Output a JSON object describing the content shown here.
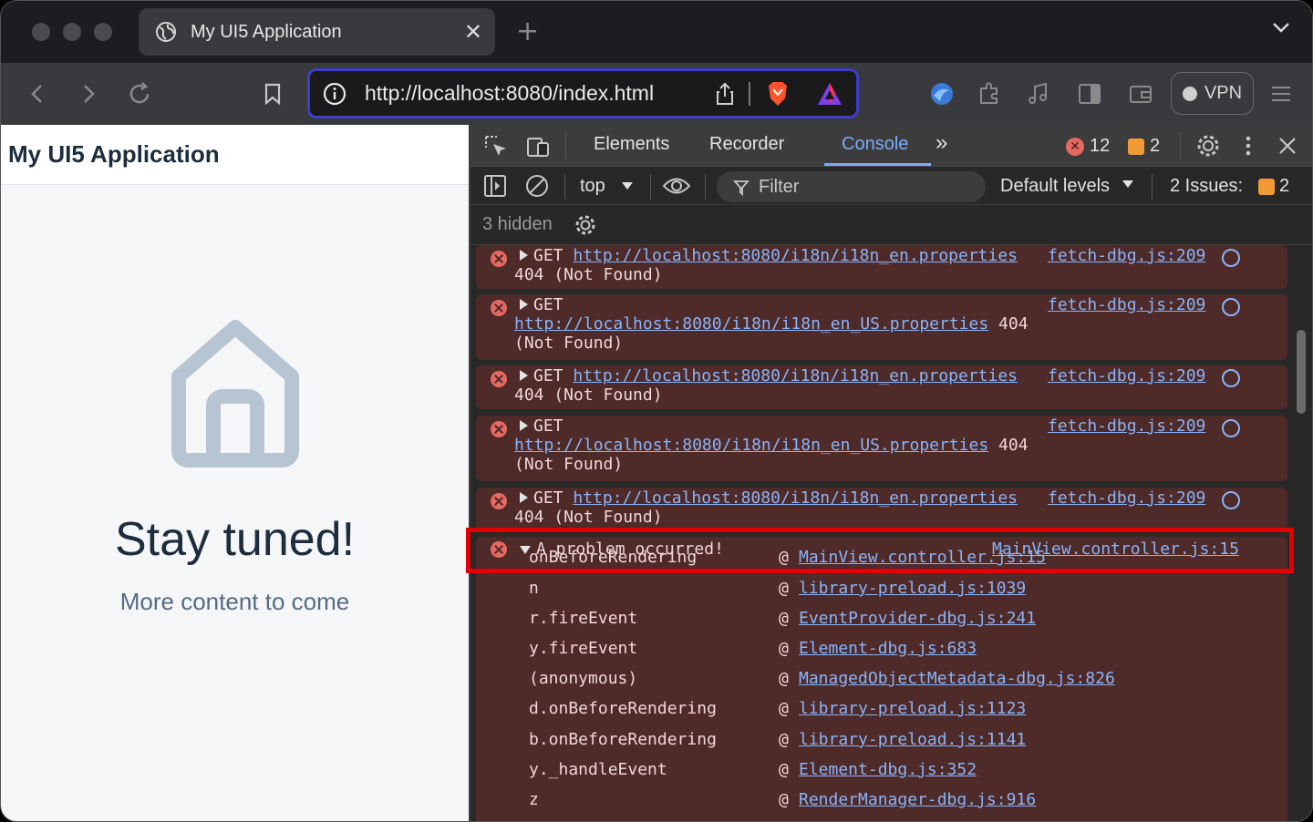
{
  "browser": {
    "tab_title": "My UI5 Application",
    "url": "http://localhost:8080/index.html",
    "vpn_label": "VPN",
    "icons": [
      "back-icon",
      "forward-icon",
      "reload-icon",
      "bookmark-icon",
      "info-icon",
      "share-icon",
      "brave-shield-icon",
      "brave-rewards-icon",
      "extension-icon",
      "puzzle-icon",
      "music-icon",
      "sidebar-icon",
      "wallet-icon",
      "menu-icon"
    ]
  },
  "page": {
    "app_title": "My UI5 Application",
    "heading": "Stay tuned!",
    "subheading": "More content to come"
  },
  "devtools": {
    "tabs": [
      "Elements",
      "Recorder",
      "Console"
    ],
    "active_tab": "Console",
    "error_count": "12",
    "warning_count": "2",
    "context": "top",
    "filter_placeholder": "Filter",
    "levels": "Default levels",
    "issues_label": "2 Issues:",
    "issues_count": "2",
    "hidden": "3 hidden",
    "messages": [
      {
        "method": "GET",
        "url": "http://localhost:8080/i18n/i18n_en.properties",
        "status": "404 (Not Found)",
        "source": "fetch-dbg.js:209"
      },
      {
        "method": "GET",
        "url": "http://localhost:8080/i18n/i18n_en_US.properties",
        "status": "404",
        "status2": "(Not Found)",
        "source": "fetch-dbg.js:209"
      },
      {
        "method": "GET",
        "url": "http://localhost:8080/i18n/i18n_en.properties",
        "status": "404 (Not Found)",
        "source": "fetch-dbg.js:209"
      },
      {
        "method": "GET",
        "url": "http://localhost:8080/i18n/i18n_en_US.properties",
        "status": "404",
        "status2": "(Not Found)",
        "source": "fetch-dbg.js:209"
      },
      {
        "method": "GET",
        "url": "http://localhost:8080/i18n/i18n_en.properties",
        "status": "404 (Not Found)",
        "source": "fetch-dbg.js:209"
      }
    ],
    "problem": {
      "text": "A problem occurred!",
      "source": "MainView.controller.js:15"
    },
    "stack": [
      {
        "fn": "onBeforeRendering",
        "loc": "MainView.controller.js:15"
      },
      {
        "fn": "n",
        "loc": "library-preload.js:1039"
      },
      {
        "fn": "r.fireEvent",
        "loc": "EventProvider-dbg.js:241"
      },
      {
        "fn": "y.fireEvent",
        "loc": "Element-dbg.js:683"
      },
      {
        "fn": "(anonymous)",
        "loc": "ManagedObjectMetadata-dbg.js:826"
      },
      {
        "fn": "d.onBeforeRendering",
        "loc": "library-preload.js:1123"
      },
      {
        "fn": "b.onBeforeRendering",
        "loc": "library-preload.js:1141"
      },
      {
        "fn": "y._handleEvent",
        "loc": "Element-dbg.js:352"
      },
      {
        "fn": "z",
        "loc": "RenderManager-dbg.js:916"
      }
    ]
  }
}
